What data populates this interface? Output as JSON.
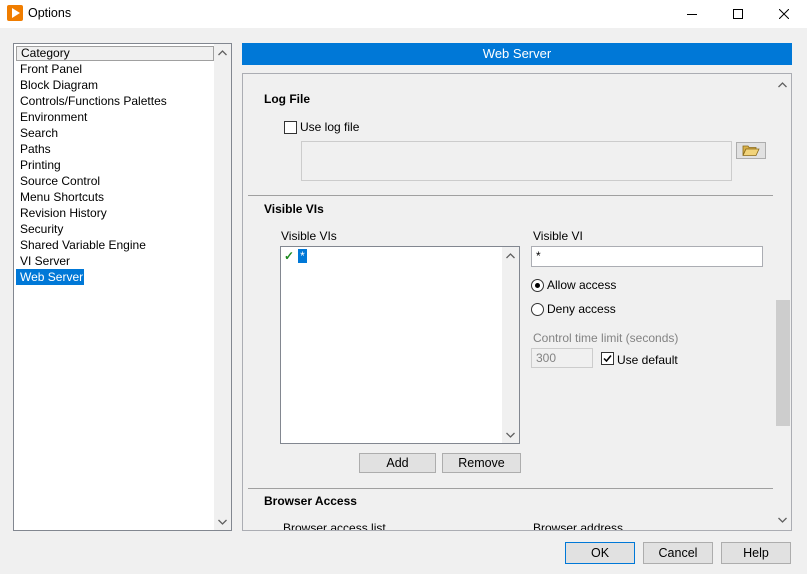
{
  "window": {
    "title": "Options",
    "icon": "labview-icon"
  },
  "categories": {
    "header": "Category",
    "items": [
      "Front Panel",
      "Block Diagram",
      "Controls/Functions Palettes",
      "Environment",
      "Search",
      "Paths",
      "Printing",
      "Source Control",
      "Menu Shortcuts",
      "Revision History",
      "Security",
      "Shared Variable Engine",
      "VI Server",
      "Web Server"
    ],
    "selected": "Web Server"
  },
  "panel": {
    "title": "Web Server",
    "log_file": {
      "section_title": "Log File",
      "use_log_file_label": "Use log file",
      "use_log_file_checked": false,
      "path_value": ""
    },
    "visible_vis": {
      "section_title": "Visible VIs",
      "list_label": "Visible VIs",
      "list_items": [
        {
          "check": "✓",
          "text": "*"
        }
      ],
      "visible_vi_label": "Visible VI",
      "visible_vi_value": "*",
      "allow_access_label": "Allow access",
      "deny_access_label": "Deny access",
      "selected_access": "Allow access",
      "control_time_limit_label": "Control time limit (seconds)",
      "control_time_limit_value": "300",
      "use_default_label": "Use default",
      "use_default_checked": true,
      "add_label": "Add",
      "remove_label": "Remove"
    },
    "browser_access": {
      "section_title": "Browser Access",
      "list_label": "Browser access list",
      "address_label": "Browser address"
    }
  },
  "footer": {
    "ok_label": "OK",
    "cancel_label": "Cancel",
    "help_label": "Help"
  },
  "colors": {
    "accent": "#0078d7",
    "app_icon": "#f07d00",
    "disabled_text": "#838383"
  }
}
